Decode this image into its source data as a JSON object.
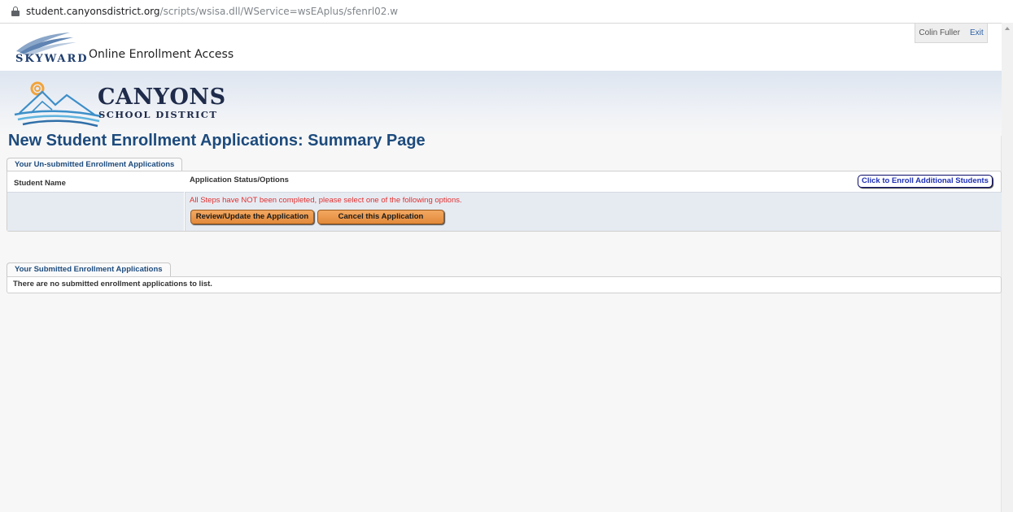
{
  "browser": {
    "url_host": "student.canyonsdistrict.org",
    "url_path": "/scripts/wsisa.dll/WService=wsEAplus/sfenrl02.w"
  },
  "header": {
    "brand": "SKYWARD",
    "app_title": "Online Enrollment Access",
    "user_name": "Colin Fuller",
    "exit_label": "Exit"
  },
  "banner": {
    "district_name": "CANYONS",
    "district_subtitle": "SCHOOL DISTRICT"
  },
  "page_title": "New Student Enrollment Applications: Summary Page",
  "unsubmitted": {
    "tab_label": "Your Un-submitted Enrollment Applications",
    "col_student_name": "Student Name",
    "col_status": "Application Status/Options",
    "enroll_button": "Click to Enroll Additional Students",
    "warning": "All Steps have NOT been completed, please select one of the following options.",
    "review_button": "Review/Update the Application",
    "cancel_button": "Cancel this Application"
  },
  "submitted": {
    "tab_label": "Your Submitted Enrollment Applications",
    "empty_message": "There are no submitted enrollment applications to list."
  },
  "colors": {
    "title_blue": "#1d4b7d",
    "warning_red": "#e03030",
    "button_orange": "#e8903f"
  }
}
